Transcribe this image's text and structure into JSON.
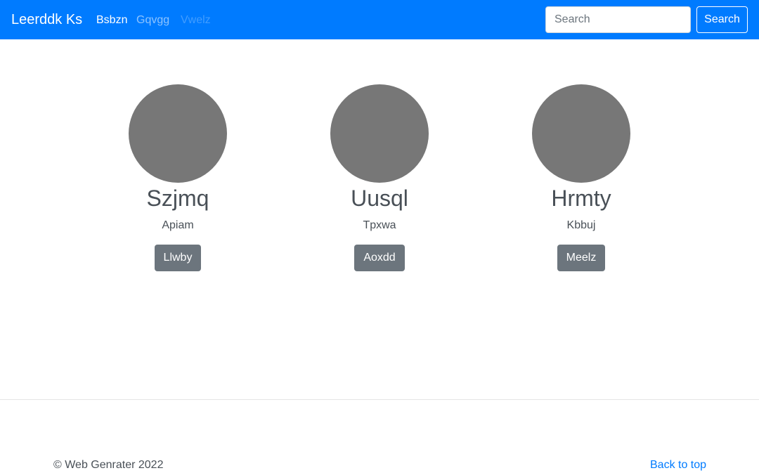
{
  "navbar": {
    "brand": "Leerddk Ks",
    "links": [
      "Bsbzn",
      "Gqvgg",
      "Vwelz"
    ],
    "search_placeholder": "Search",
    "search_button": "Search",
    "color": "#007bff"
  },
  "cards": [
    {
      "title": "Szjmq",
      "subtitle": "Apiam",
      "button": "Llwby"
    },
    {
      "title": "Uusql",
      "subtitle": "Tpxwa",
      "button": "Aoxdd"
    },
    {
      "title": "Hrmty",
      "subtitle": "Kbbuj",
      "button": "Meelz"
    }
  ],
  "footer": {
    "copyright": "© Web Genrater 2022",
    "back_to_top": "Back to top"
  }
}
